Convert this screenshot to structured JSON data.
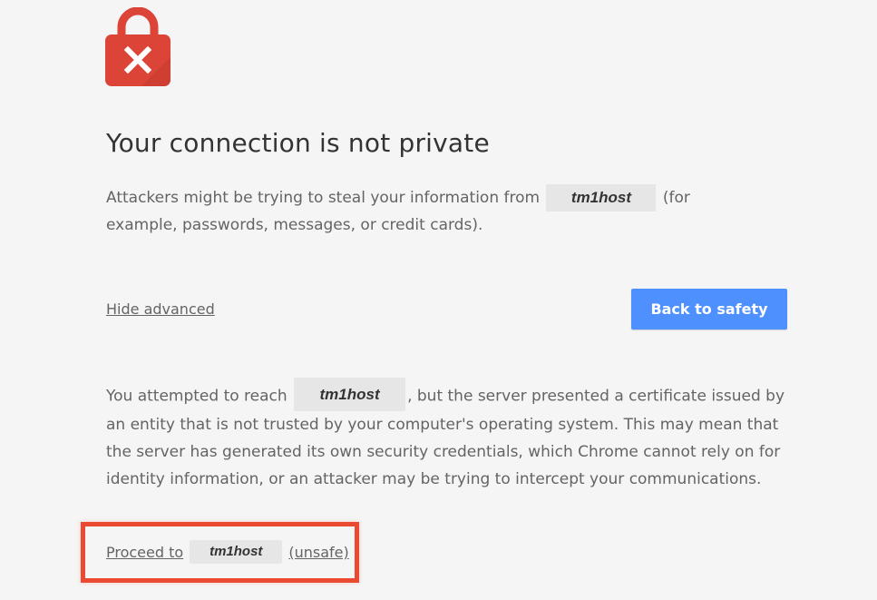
{
  "interstitial": {
    "title": "Your connection is not private",
    "intro": {
      "before_host": "Attackers might be trying to steal your information from",
      "host": "tm1host",
      "after_host": "(for example, passwords, messages, or credit cards)."
    },
    "hide_advanced_label": "Hide advanced",
    "back_to_safety_label": "Back to safety",
    "details": {
      "before_host": "You attempted to reach",
      "host": "tm1host",
      "after_host": ", but the server presented a certificate issued by an entity that is not trusted by your computer's operating system. This may mean that the server has generated its own security credentials, which Chrome cannot rely on for identity information, or an attacker may be trying to intercept your communications."
    },
    "proceed": {
      "prefix": "Proceed to",
      "host": "tm1host",
      "suffix": "(unsafe)"
    }
  },
  "colors": {
    "lock_red": "#db4437",
    "button_blue": "#4d90fe",
    "highlight_border": "#ea4a32",
    "background": "#f5f5f5"
  },
  "icons": {
    "lock": "lock-error-icon"
  }
}
